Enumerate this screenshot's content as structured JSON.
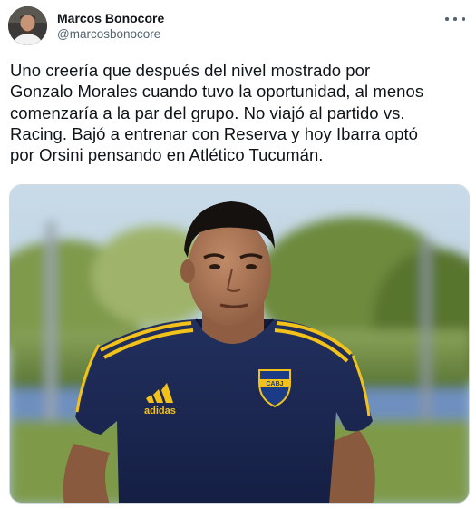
{
  "author": {
    "name": "Marcos Bonocore",
    "handle": "@marcosbonocore"
  },
  "tweet": {
    "lines": [
      "Uno creería que después del nivel mostrado por",
      "Gonzalo Morales cuando tuvo la oportunidad, al menos",
      "comenzaría a la par del grupo. No viajó al partido vs.",
      "Racing. Bajó a entrenar con Reserva y hoy Ibarra optó",
      "por Orsini pensando en Atlético Tucumán."
    ]
  },
  "media": {
    "shirt_brand": "adidas",
    "crest_text": "CABJ",
    "colors": {
      "shirt": "#1d2a55",
      "stripe": "#f2c21a",
      "sky": "#b9cfe0",
      "grass": "#6f8e3a"
    }
  },
  "icons": {
    "more": "more-horizontal-icon",
    "avatar": "avatar-photo"
  }
}
